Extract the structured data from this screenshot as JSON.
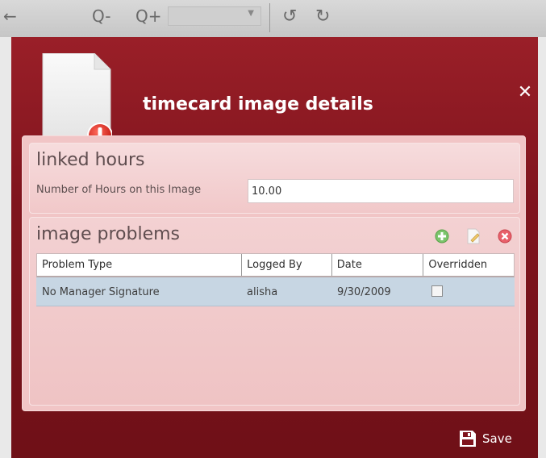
{
  "window": {
    "title": "timecard image details",
    "close_icon": "close-icon",
    "file_icon": "document-error-icon"
  },
  "toolbar": {
    "icons": [
      "back-icon",
      "zoom-out-icon",
      "zoom-in-icon",
      "rotate-left-icon",
      "rotate-right-icon"
    ],
    "zoom_out_glyph": "Q-",
    "zoom_in_glyph": "Q+"
  },
  "linked_hours": {
    "heading": "linked hours",
    "field_label": "Number of Hours on this Image",
    "hours_value": "10.00"
  },
  "image_problems": {
    "heading": "image problems",
    "tools": [
      "add-icon",
      "edit-icon",
      "delete-icon"
    ],
    "columns": [
      "Problem Type",
      "Logged By",
      "Date",
      "Overridden"
    ],
    "rows": [
      {
        "problem_type": "No Manager Signature",
        "logged_by": "alisha",
        "date": "9/30/2009",
        "overridden": false
      }
    ]
  },
  "footer": {
    "save_label": "Save",
    "save_icon": "floppy-disk-icon"
  },
  "colors": {
    "dialog_bg": "#7f141d",
    "panel_bg": "#f1c5c6",
    "row_selected": "#c7d6e3",
    "add_green": "#4cae4c",
    "delete_red": "#d9534f"
  }
}
